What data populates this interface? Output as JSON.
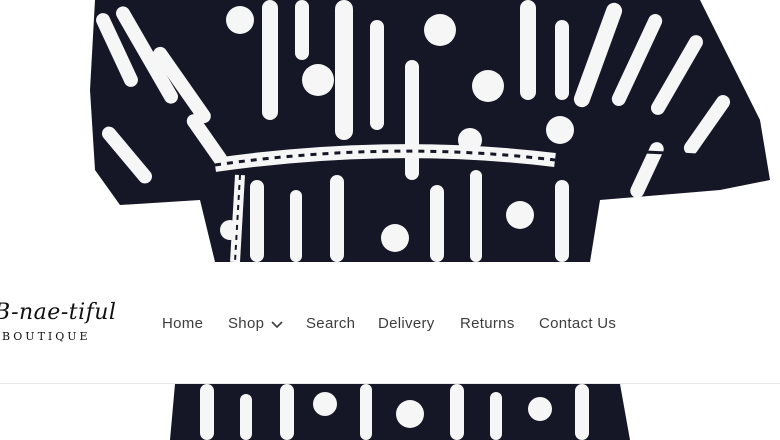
{
  "logo": {
    "script_text": "B-nae-tiful",
    "subtitle": "BOUTIQUE"
  },
  "nav": {
    "items": [
      {
        "label": "Home"
      },
      {
        "label": "Shop",
        "has_dropdown": true,
        "icon": "chevron-down-icon"
      },
      {
        "label": "Search"
      },
      {
        "label": "Delivery"
      },
      {
        "label": "Returns"
      },
      {
        "label": "Contact Us"
      }
    ]
  },
  "colors": {
    "pattern_dark": "#151726",
    "pattern_light": "#f6f6f6",
    "nav_text": "#3d3d3d"
  }
}
